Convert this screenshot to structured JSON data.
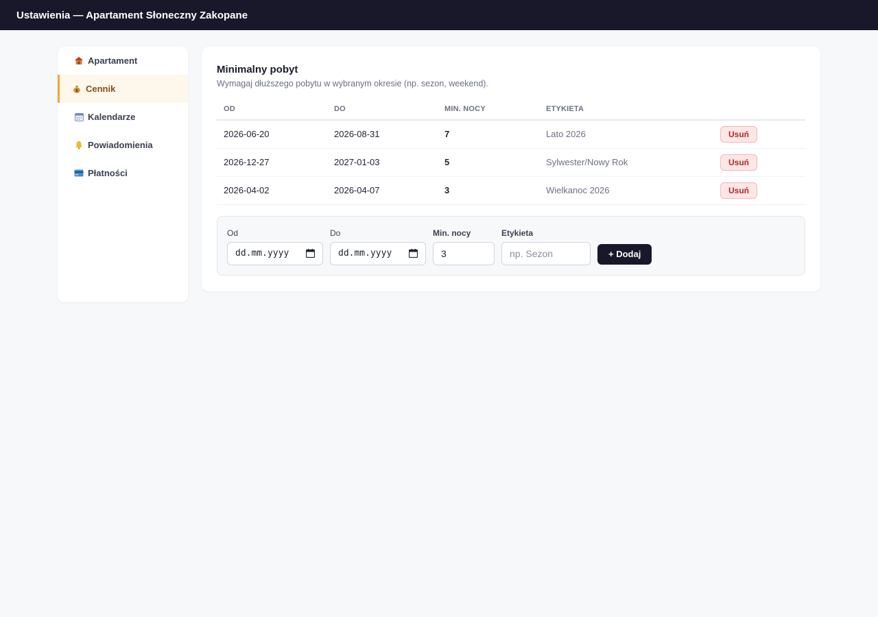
{
  "header": {
    "title": "Ustawienia — Apartament Słoneczny Zakopane"
  },
  "sidebar": {
    "items": [
      {
        "label": "Apartament",
        "icon": "house-icon"
      },
      {
        "label": "Cennik",
        "icon": "money-bag-icon",
        "active": true
      },
      {
        "label": "Kalendarze",
        "icon": "calendar-icon"
      },
      {
        "label": "Powiadomienia",
        "icon": "bell-icon"
      },
      {
        "label": "Płatności",
        "icon": "credit-card-icon"
      }
    ]
  },
  "main": {
    "title": "Minimalny pobyt",
    "subtitle": "Wymagaj dłuższego pobytu w wybranym okresie (np. sezon, weekend).",
    "table": {
      "columns": [
        "OD",
        "DO",
        "MIN. NOCY",
        "ETYKIETA"
      ],
      "rows": [
        {
          "from": "2026-06-20",
          "to": "2026-08-31",
          "min": "7",
          "label": "Lato 2026",
          "action": "Usuń"
        },
        {
          "from": "2026-12-27",
          "to": "2027-01-03",
          "min": "5",
          "label": "Sylwester/Nowy Rok",
          "action": "Usuń"
        },
        {
          "from": "2026-04-02",
          "to": "2026-04-07",
          "min": "3",
          "label": "Wielkanoc 2026",
          "action": "Usuń"
        }
      ]
    },
    "form": {
      "from_label": "Od",
      "from_value": "dd.mm.yyyy",
      "to_label": "Do",
      "to_value": "dd.mm.yyyy",
      "min_label": "Min. nocy",
      "min_value": "3",
      "tag_label": "Etykieta",
      "tag_placeholder": "np. Sezon",
      "add_button": "+ Dodaj"
    }
  },
  "colors": {
    "topbar": "#18182a",
    "accent": "#f0a830",
    "danger": "#b3262b"
  }
}
